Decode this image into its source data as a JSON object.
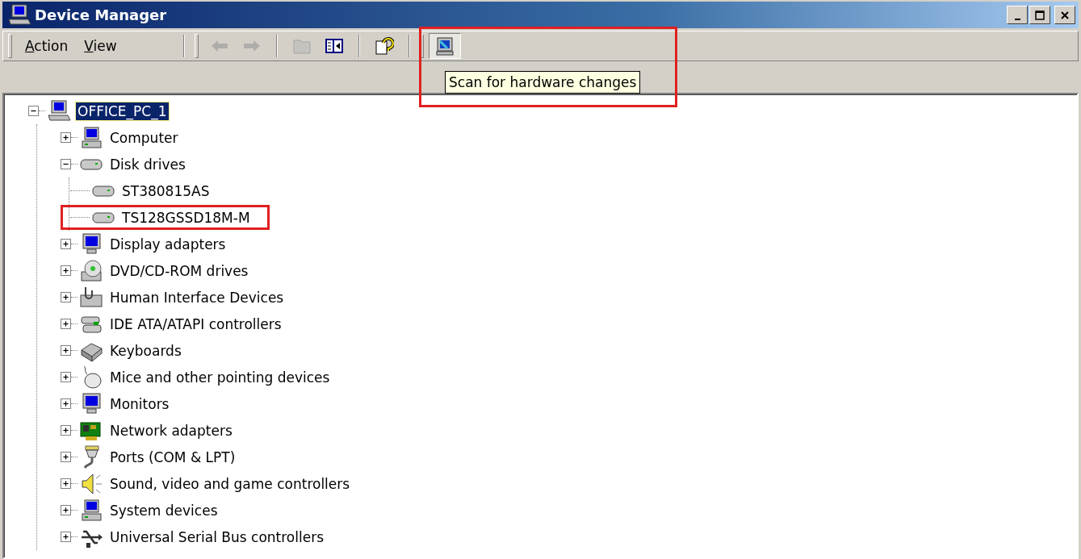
{
  "window": {
    "title": "Device Manager",
    "controls": [
      {
        "kind": "minimize"
      },
      {
        "kind": "maximize"
      },
      {
        "kind": "close"
      }
    ]
  },
  "menu": [
    {
      "label": "Action"
    },
    {
      "label": "View"
    }
  ],
  "toolbar": [
    {
      "kind": "back",
      "disabled": true
    },
    {
      "kind": "forward",
      "disabled": true
    },
    {
      "kind": "properties",
      "disabled": true
    },
    {
      "kind": "console_tree",
      "disabled": false
    },
    {
      "kind": "help",
      "disabled": false
    },
    {
      "kind": "scan",
      "disabled": false,
      "annotated": true
    }
  ],
  "tooltip": {
    "text": "Scan for hardware changes"
  },
  "tree": {
    "label": "OFFICE_PC_1",
    "expanded": true,
    "selected": true,
    "children": [
      {
        "label": "Computer",
        "expanded": false,
        "selected": false
      },
      {
        "label": "Disk drives",
        "expanded": true,
        "selected": false,
        "children": [
          {
            "label": "ST380815AS",
            "selected": false,
            "annotated": false
          },
          {
            "label": "TS128GSSD18M-M",
            "selected": false,
            "annotated": true
          }
        ]
      },
      {
        "label": "Display adapters",
        "expanded": false,
        "selected": false
      },
      {
        "label": "DVD/CD-ROM drives",
        "expanded": false,
        "selected": false
      },
      {
        "label": "Human Interface Devices",
        "expanded": false,
        "selected": false
      },
      {
        "label": "IDE ATA/ATAPI controllers",
        "expanded": false,
        "selected": false
      },
      {
        "label": "Keyboards",
        "expanded": false,
        "selected": false
      },
      {
        "label": "Mice and other pointing devices",
        "expanded": false,
        "selected": false
      },
      {
        "label": "Monitors",
        "expanded": false,
        "selected": false
      },
      {
        "label": "Network adapters",
        "expanded": false,
        "selected": false
      },
      {
        "label": "Ports (COM & LPT)",
        "expanded": false,
        "selected": false
      },
      {
        "label": "Sound, video and game controllers",
        "expanded": false,
        "selected": false
      },
      {
        "label": "System devices",
        "expanded": false,
        "selected": false
      },
      {
        "label": "Universal Serial Bus controllers",
        "expanded": false,
        "selected": false
      }
    ]
  }
}
